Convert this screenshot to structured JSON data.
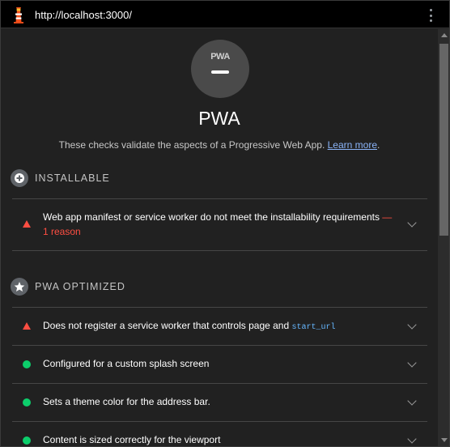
{
  "toolbar": {
    "url": "http://localhost:3000/",
    "logo_icon": "lighthouse-icon",
    "menu_icon": "kebab-menu-icon"
  },
  "category": {
    "gauge_badge": "PWA",
    "title": "PWA",
    "description": "These checks validate the aspects of a Progressive Web App. ",
    "learn_more": "Learn more",
    "period": "."
  },
  "groups": {
    "installable": {
      "title": "Installable",
      "icon": "plus-circle-icon",
      "audits": [
        {
          "status": "fail",
          "text": "Web app manifest or service worker do not meet the installability requirements",
          "suffix": " — ",
          "detail": "1 reason"
        }
      ]
    },
    "optimized": {
      "title": "PWA Optimized",
      "icon": "star-icon",
      "audits": [
        {
          "status": "fail",
          "text": "Does not register a service worker that controls page and ",
          "code": "start_url"
        },
        {
          "status": "pass",
          "text": "Configured for a custom splash screen"
        },
        {
          "status": "pass",
          "text": "Sets a theme color for the address bar."
        },
        {
          "status": "pass",
          "text": "Content is sized correctly for the viewport"
        }
      ]
    }
  },
  "colors": {
    "fail": "#ff4e42",
    "pass": "#0cce6b",
    "link": "#8ab4f8",
    "code": "#66b7ff",
    "background": "#212121"
  }
}
